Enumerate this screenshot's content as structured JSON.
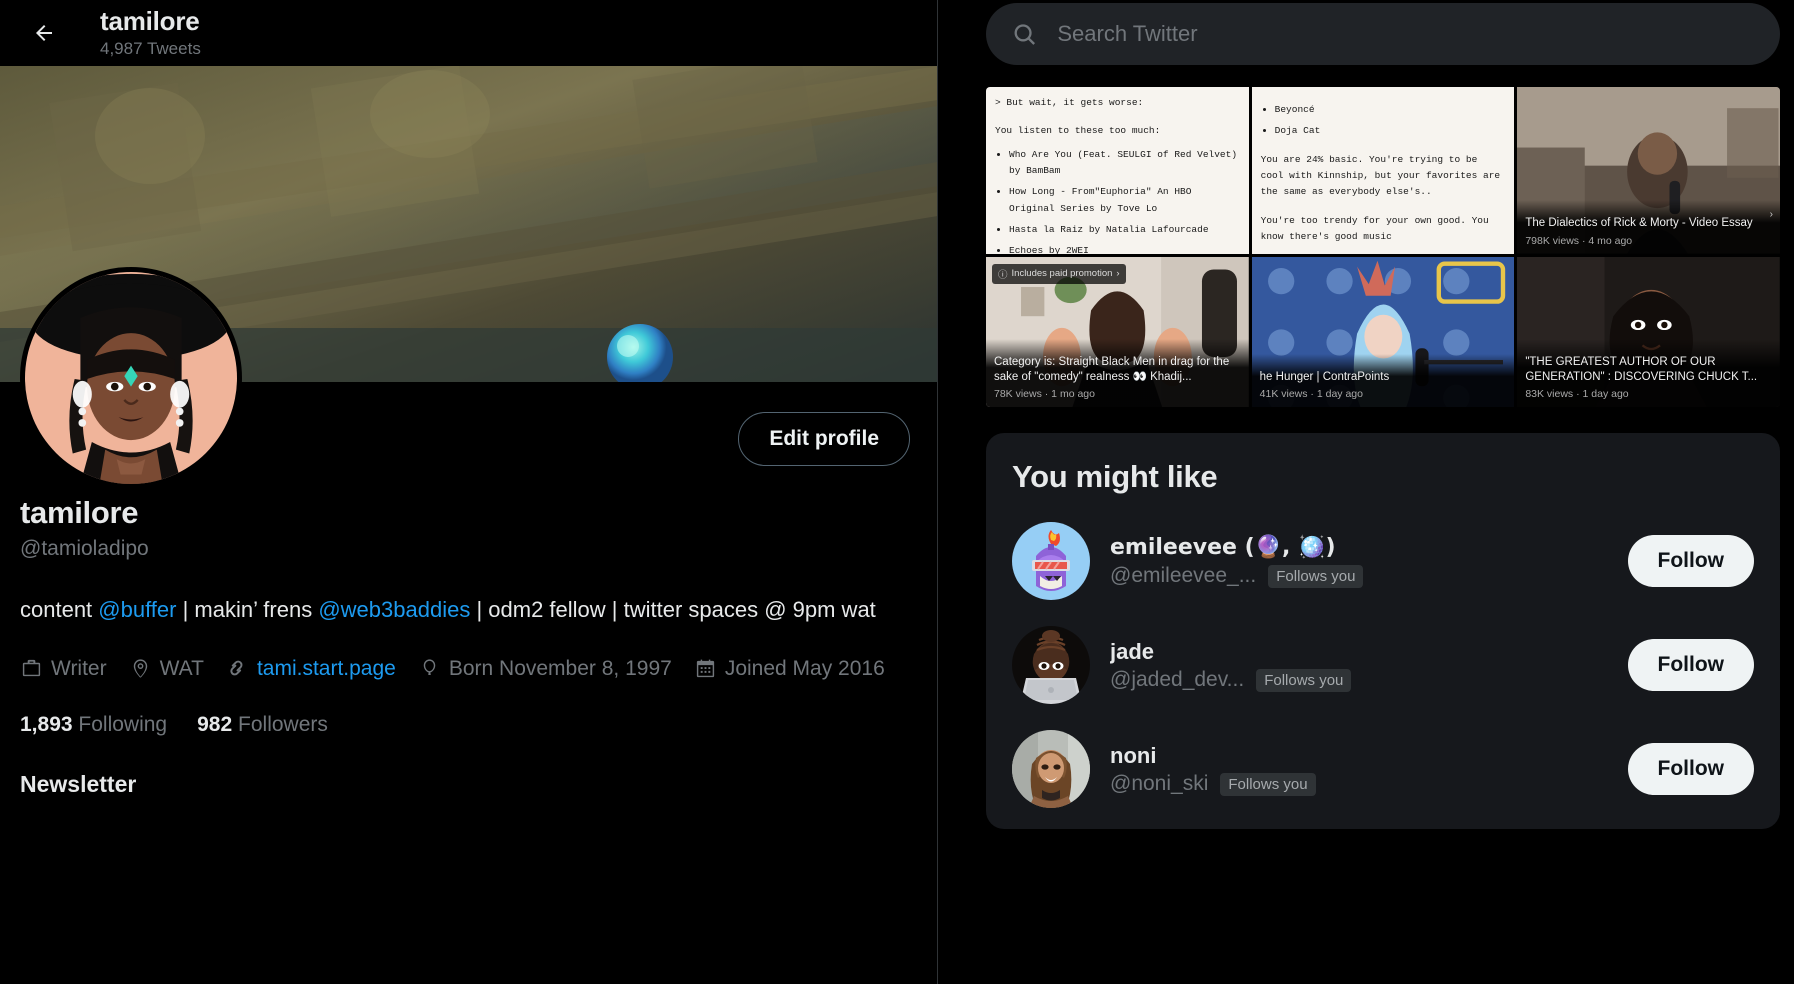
{
  "header": {
    "back_icon": "arrow-left-icon",
    "name": "tamilore",
    "tweet_count": "4,987 Tweets"
  },
  "profile": {
    "edit_button": "Edit profile",
    "display_name": "tamilore",
    "handle": "@tamioladipo",
    "bio": {
      "part1": "content ",
      "mention1": "@buffer",
      "part2": " | makin’ frens ",
      "mention2": "@web3baddies",
      "part3": " | odm2 fellow | twitter spaces @ 9pm wat"
    },
    "meta": {
      "profession": "Writer",
      "location": "WAT",
      "website": "tami.start.page",
      "birthday": "Born November 8, 1997",
      "joined": "Joined May 2016"
    },
    "stats": {
      "following_count": "1,893",
      "following_label": "Following",
      "followers_count": "982",
      "followers_label": "Followers"
    },
    "newsletter_heading": "Newsletter"
  },
  "search": {
    "placeholder": "Search Twitter",
    "value": "",
    "icon": "search-icon"
  },
  "media_tiles": [
    {
      "type": "text",
      "heading": "> But wait, it gets worse:",
      "intro": "You listen to these too much:",
      "items": [
        "Who Are You (Feat. SEULGI of Red Velvet) by BamBam",
        "How Long - From\"Euphoria\" An HBO Original Series by Tove Lo",
        "Hasta la Raiz by Natalia Lafourcade",
        "Echoes by 2WEI"
      ]
    },
    {
      "type": "text",
      "items": [
        "Beyoncé",
        "Doja Cat"
      ],
      "paragraphs": [
        "You are 24% basic. You're trying to be cool with Kinnship, but your favorites are the same as everybody else's..",
        "You're too trendy for your own good. You know there's good music"
      ]
    },
    {
      "type": "video",
      "title": "The Dialectics of Rick & Morty - Video Essay",
      "meta": "798K views · 4 mo ago"
    },
    {
      "type": "video",
      "badge": "Includes paid promotion",
      "title": "Category is: Straight Black Men in drag for the sake of \"comedy\" realness 👀 Khadij...",
      "meta": "78K views · 1 mo ago"
    },
    {
      "type": "video",
      "title": "he Hunger | ContraPoints",
      "meta": "41K views · 1 day ago"
    },
    {
      "type": "video",
      "title": "\"THE GREATEST AUTHOR OF OUR GENERATION\" : DISCOVERING CHUCK T...",
      "meta": "83K views · 1 day ago"
    }
  ],
  "you_might_like": {
    "title": "You might like",
    "users": [
      {
        "name": "emileevee (🔮, 🪩)",
        "handle": "@emileevee_...",
        "badge": "Follows you",
        "follow_label": "Follow",
        "avatar": "pixel-monster-avatar"
      },
      {
        "name": "jade",
        "handle": "@jaded_dev...",
        "badge": "Follows you",
        "follow_label": "Follow",
        "avatar": "memoji-laptop-avatar"
      },
      {
        "name": "noni",
        "handle": "@noni_ski",
        "badge": "Follows you",
        "follow_label": "Follow",
        "avatar": "photo-portrait-avatar"
      }
    ]
  },
  "colors": {
    "accent": "#1d9bf0",
    "background": "#000000",
    "card": "#16181c",
    "text_primary": "#e7e9ea",
    "text_secondary": "#71767b"
  }
}
